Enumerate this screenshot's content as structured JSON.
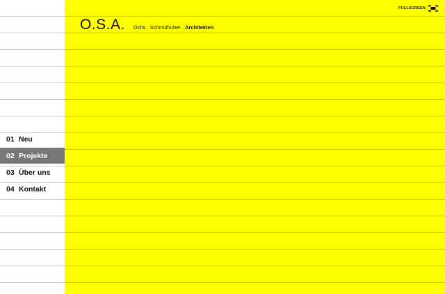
{
  "brand": {
    "mark": "O.S.A.",
    "subtitle_plain": "Ochs . Schmidhuber . ",
    "subtitle_bold": "Architekten"
  },
  "header": {
    "fullscreen_label": "FULLSCREEN",
    "fullscreen_icon": "fullscreen-icon"
  },
  "nav": {
    "items": [
      {
        "num": "01",
        "label": "Neu",
        "active": false
      },
      {
        "num": "02",
        "label": "Projekte",
        "active": true
      },
      {
        "num": "03",
        "label": "Über uns",
        "active": false
      },
      {
        "num": "04",
        "label": "Kontakt",
        "active": false
      }
    ]
  },
  "colors": {
    "accent": "#ffff00",
    "active_item_bg": "#777777",
    "rule_line": "#c9c9c9"
  }
}
